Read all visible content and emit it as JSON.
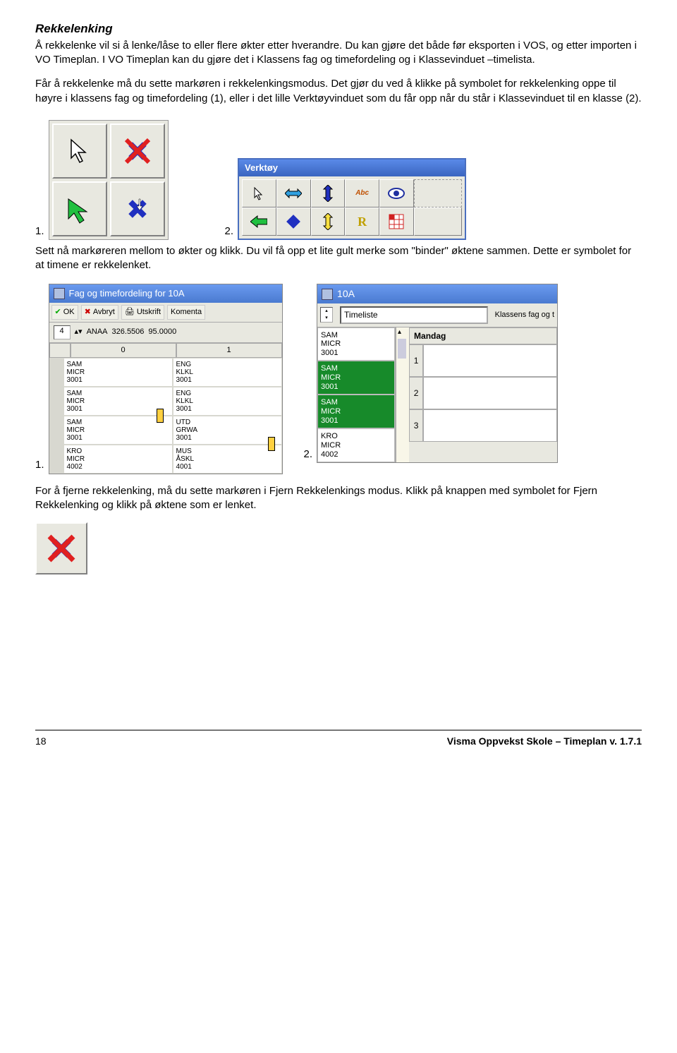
{
  "heading": "Rekkelenking",
  "para1": "Å rekkelenke vil si å lenke/låse to eller flere økter etter hverandre. Du kan gjøre det både før eksporten i VOS, og etter importen i VO Timeplan. I VO Timeplan kan du gjøre det i Klassens fag og timefordeling og i Klassevinduet –timelista.",
  "para2": "Får å rekkelenke må du sette markøren i rekkelenkingsmodus. Det gjør du ved å klikke på symbolet for rekkelenking oppe til høyre i klassens fag og timefordeling (1), eller i det lille Verktøyvinduet som du får opp når du står i Klassevinduet til en klasse (2).",
  "fig1": "1.",
  "fig2": "2.",
  "para3": "Sett nå markøreren mellom to økter og klikk. Du vil få opp et lite gult merke som \"binder\" øktene sammen. Dette er symbolet for at timene er rekkelenket.",
  "para4": "For å fjerne rekkelenking, må du sette markøren i Fjern Rekkelenkings modus. Klikk på knappen med symbolet for Fjern Rekkelenking og klikk på øktene som er lenket.",
  "verktoy_title": "Verktøy",
  "win1": {
    "title": "Fag og timefordeling for 10A",
    "btn_ok": "OK",
    "btn_avbryt": "Avbryt",
    "btn_utskrift": "Utskrift",
    "btn_komenta": "Komenta",
    "spin": "4",
    "line2_fields": [
      "ANAA",
      "326.5506",
      "95.0000"
    ],
    "hdr": [
      "0",
      "1"
    ],
    "col0": [
      "SAM\nMICR\n3001",
      "SAM\nMICR\n3001",
      "SAM\nMICR\n3001",
      "KRO\nMICR\n4002"
    ],
    "col1": [
      "ENG\nKLKL\n3001",
      "ENG\nKLKL\n3001",
      "UTD\nGRWA\n3001",
      "MUS\nÅSKL\n4001"
    ]
  },
  "win2": {
    "title": "10A",
    "combo": "Timeliste",
    "right_label": "Klassens fag og t",
    "timeliste": [
      "SAM\nMICR\n3001",
      "SAM\nMICR\n3001",
      "SAM\nMICR\n3001",
      "KRO\nMICR\n4002"
    ],
    "mandag": "Mandag",
    "nums": [
      "1",
      "2",
      "3"
    ]
  },
  "footer_left": "18",
  "footer_right": "Visma Oppvekst Skole – Timeplan v. 1.7.1"
}
